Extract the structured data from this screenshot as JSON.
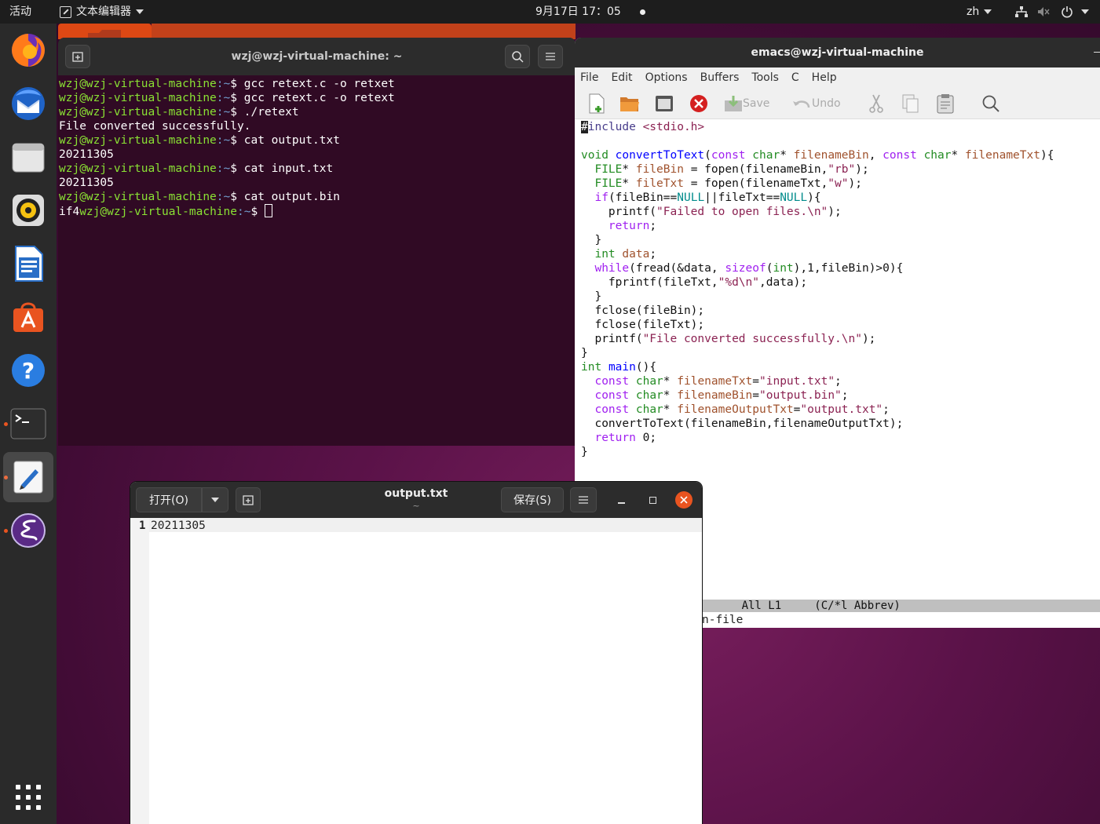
{
  "topbar": {
    "activities": "活动",
    "app_name": "文本编辑器",
    "clock": "9月17日 17：05",
    "lang": "zh"
  },
  "dock": {
    "items": [
      "firefox-icon",
      "thunderbird-icon",
      "files-icon",
      "rhythmbox-icon",
      "writer-icon",
      "software-icon",
      "help-icon",
      "terminal-icon",
      "text-editor-icon",
      "emacs-icon",
      "apps-grid-icon"
    ]
  },
  "terminal": {
    "title": "wzj@wzj-virtual-machine: ~",
    "prompt_user": "wzj@wzj-virtual-machine",
    "prompt_path": ":~",
    "prompt_sym": "$ ",
    "lines": [
      {
        "cmd": "gcc retext.c -o retxet"
      },
      {
        "cmd": "gcc retext.c -o retext"
      },
      {
        "cmd": "./retext"
      },
      {
        "out": "File converted successfully."
      },
      {
        "cmd": "cat output.txt"
      },
      {
        "out": "20211305"
      },
      {
        "cmd": "cat input.txt"
      },
      {
        "out": "20211305"
      },
      {
        "cmd": "cat output.bin"
      }
    ],
    "last_prefix": "if4"
  },
  "emacs": {
    "title": "emacs@wzj-virtual-machine",
    "menu": [
      "File",
      "Edit",
      "Options",
      "Buffers",
      "Tools",
      "C",
      "Help"
    ],
    "toolbar": {
      "save": "Save",
      "undo": "Undo"
    },
    "modeline": "      All L1     (C/*l Abbrev)",
    "minibuffer": "n-file"
  },
  "gedit": {
    "open_label": "打开(O)",
    "save_label": "保存(S)",
    "title": "output.txt",
    "subtitle": "~",
    "line_number": "1",
    "content": "20211305"
  },
  "colors": {
    "ubuntu_orange": "#e95420",
    "terminal_bg": "#300a24",
    "prompt_green": "#8ae234",
    "prompt_blue": "#729fcf"
  }
}
